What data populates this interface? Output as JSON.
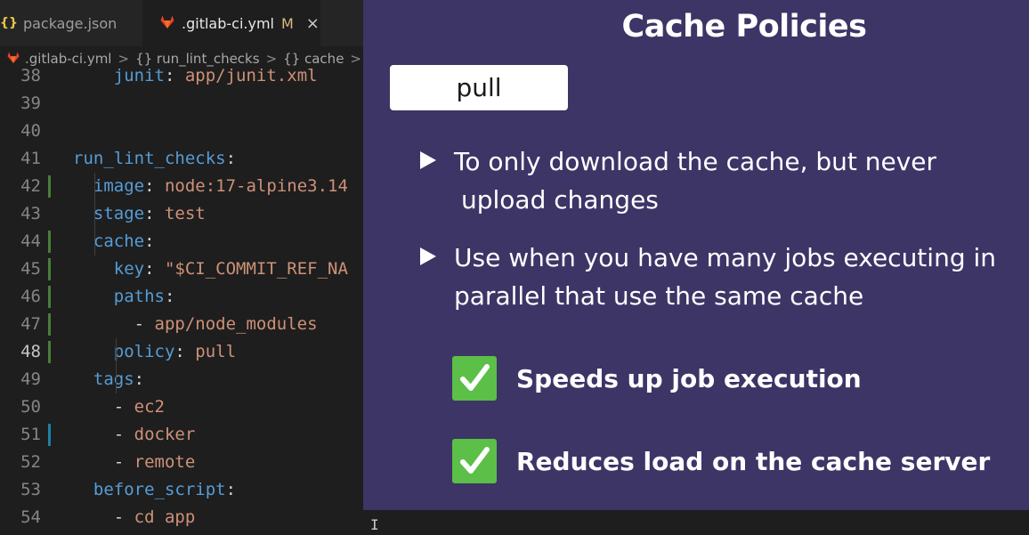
{
  "editor": {
    "tabs": [
      {
        "icon": "{}",
        "label": "package.json"
      },
      {
        "label": ".gitlab-ci.yml",
        "modified": "M",
        "close": "×"
      }
    ],
    "breadcrumbs": [
      ".gitlab-ci.yml",
      "{} run_lint_checks",
      "{} cache",
      "{"
    ],
    "breadcrumb_sep": ">",
    "lines": [
      {
        "n": "38",
        "indent": "    ",
        "key": "junit",
        "colon": ": ",
        "val": "app/junit.xml"
      },
      {
        "n": "39",
        "text": ""
      },
      {
        "n": "40",
        "text": ""
      },
      {
        "n": "41",
        "indent": "",
        "key": "run_lint_checks",
        "colon": ":",
        "val": ""
      },
      {
        "n": "42",
        "indent": "  ",
        "key": "image",
        "colon": ": ",
        "val": "node:17-alpine3.14"
      },
      {
        "n": "43",
        "indent": "  ",
        "key": "stage",
        "colon": ": ",
        "val": "test"
      },
      {
        "n": "44",
        "indent": "  ",
        "key": "cache",
        "colon": ":",
        "val": ""
      },
      {
        "n": "45",
        "indent": "    ",
        "key": "key",
        "colon": ": ",
        "val": "\"$CI_COMMIT_REF_NA"
      },
      {
        "n": "46",
        "indent": "    ",
        "key": "paths",
        "colon": ":",
        "val": ""
      },
      {
        "n": "47",
        "indent": "      ",
        "dash": "- ",
        "val": "app/node_modules"
      },
      {
        "n": "48",
        "indent": "    ",
        "key": "policy",
        "colon": ": ",
        "val": "pull"
      },
      {
        "n": "49",
        "indent": "  ",
        "key": "tags",
        "colon": ":",
        "val": ""
      },
      {
        "n": "50",
        "indent": "    ",
        "dash": "- ",
        "val": "ec2"
      },
      {
        "n": "51",
        "indent": "    ",
        "dash": "- ",
        "val": "docker"
      },
      {
        "n": "52",
        "indent": "    ",
        "dash": "- ",
        "val": "remote"
      },
      {
        "n": "53",
        "indent": "  ",
        "key": "before_script",
        "colon": ":",
        "val": ""
      },
      {
        "n": "54",
        "indent": "    ",
        "dash": "- ",
        "val": "cd app"
      }
    ],
    "active_line": "48",
    "colors": {
      "key": "#569cd6",
      "string": "#ce9178",
      "added": "#487e3a",
      "modified": "#1b81a8"
    }
  },
  "slide": {
    "title": "Cache Policies",
    "pill": "pull",
    "bullets": [
      {
        "line1": "To only download the cache, but never",
        "line2": "upload changes"
      },
      {
        "line1": "Use when you have many jobs executing in",
        "line2": "parallel that use the same cache"
      }
    ],
    "checks": [
      "Speeds up job execution",
      "Reduces load on the cache server"
    ],
    "colors": {
      "background": "#3c3566",
      "check": "#5cbf47"
    }
  }
}
